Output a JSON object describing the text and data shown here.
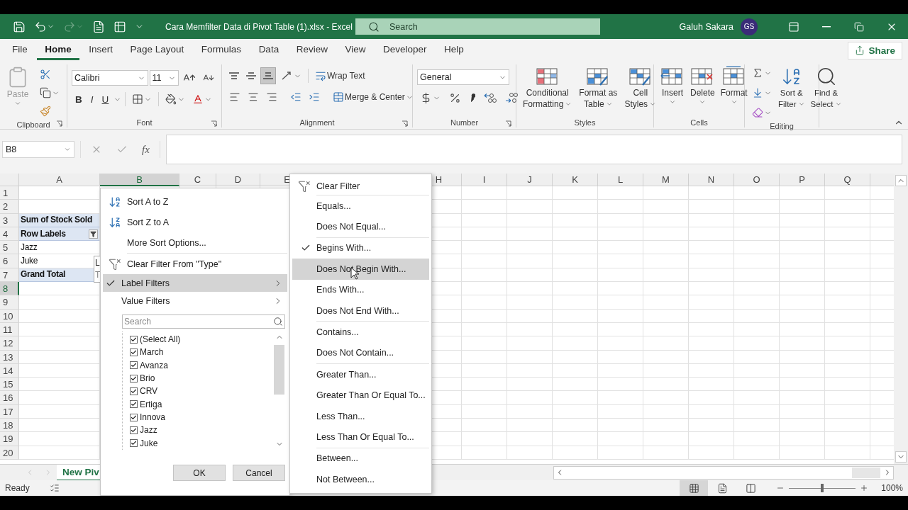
{
  "title_bar": {
    "title": "Cara Memfilter Data di Pivot Table (1).xlsx  -  Excel",
    "search_placeholder": "Search",
    "user": "Galuh Sakara",
    "initials": "GS"
  },
  "ribbon_tabs": [
    {
      "label": "File",
      "selected": false
    },
    {
      "label": "Home",
      "selected": true
    },
    {
      "label": "Insert",
      "selected": false
    },
    {
      "label": "Page Layout",
      "selected": false
    },
    {
      "label": "Formulas",
      "selected": false
    },
    {
      "label": "Data",
      "selected": false
    },
    {
      "label": "Review",
      "selected": false
    },
    {
      "label": "View",
      "selected": false
    },
    {
      "label": "Developer",
      "selected": false
    },
    {
      "label": "Help",
      "selected": false
    }
  ],
  "share": "Share",
  "clipboard": {
    "paste": "Paste",
    "label": "Clipboard"
  },
  "font": {
    "name": "Calibri",
    "size": "11",
    "bold": "B",
    "italic": "I",
    "underline": "U",
    "label": "Font"
  },
  "alignment": {
    "vertical": [
      {
        "kind": "top",
        "on": false
      },
      {
        "kind": "middle",
        "on": false
      },
      {
        "kind": "bottom",
        "on": true
      }
    ],
    "wrap_text": "Wrap Text",
    "merge": "Merge & Center",
    "label": "Alignment"
  },
  "number": {
    "format": "General",
    "label": "Number"
  },
  "styles": {
    "buttons": [
      {
        "kind": "conditional",
        "lines": [
          "Conditional",
          "Formatting"
        ]
      },
      {
        "kind": "table",
        "lines": [
          "Format as",
          "Table"
        ]
      },
      {
        "kind": "cell",
        "lines": [
          "Cell",
          "Styles"
        ]
      }
    ],
    "label": "Styles"
  },
  "cells": {
    "buttons": [
      {
        "kind": "insert",
        "label": "Insert"
      },
      {
        "kind": "delete",
        "label": "Delete"
      },
      {
        "kind": "format",
        "label": "Format"
      }
    ],
    "label": "Cells"
  },
  "editing": {
    "buttons": [
      {
        "kind": "sort",
        "lines": [
          "Sort &",
          "Filter"
        ]
      },
      {
        "kind": "find",
        "lines": [
          "Find &",
          "Select"
        ]
      }
    ],
    "label": "Editing"
  },
  "formula_bar": {
    "name_box": "B8",
    "fx": "fx"
  },
  "columns": [
    {
      "label": "A",
      "selected": false
    },
    {
      "label": "B",
      "selected": true
    },
    {
      "label": "C",
      "selected": false
    },
    {
      "label": "D",
      "selected": false
    },
    {
      "label": "E",
      "selected": false
    },
    {
      "label": "H",
      "selected": false
    },
    {
      "label": "I",
      "selected": false
    },
    {
      "label": "J",
      "selected": false
    },
    {
      "label": "K",
      "selected": false
    },
    {
      "label": "L",
      "selected": false
    },
    {
      "label": "M",
      "selected": false
    },
    {
      "label": "N",
      "selected": false
    },
    {
      "label": "O",
      "selected": false
    },
    {
      "label": "P",
      "selected": false
    },
    {
      "label": "Q",
      "selected": false
    }
  ],
  "rows": [
    {
      "number": "1",
      "selected": false
    },
    {
      "number": "2",
      "selected": false
    },
    {
      "number": "3",
      "selected": false,
      "a": {
        "kind": "title",
        "text": "Sum of Stock Sold"
      }
    },
    {
      "number": "4",
      "selected": false,
      "a": {
        "kind": "header",
        "text": "Row Labels"
      }
    },
    {
      "number": "5",
      "selected": false,
      "a": {
        "kind": "item",
        "text": "Jazz"
      }
    },
    {
      "number": "6",
      "selected": false,
      "a": {
        "kind": "item",
        "text": "Juke"
      }
    },
    {
      "number": "7",
      "selected": false,
      "a": {
        "kind": "total",
        "text": "Grand Total"
      }
    },
    {
      "number": "8",
      "selected": true
    },
    {
      "number": "9",
      "selected": false
    },
    {
      "number": "10",
      "selected": false
    },
    {
      "number": "11",
      "selected": false
    },
    {
      "number": "12",
      "selected": false
    },
    {
      "number": "13",
      "selected": false
    },
    {
      "number": "14",
      "selected": false
    },
    {
      "number": "15",
      "selected": false
    },
    {
      "number": "16",
      "selected": false
    },
    {
      "number": "17",
      "selected": false
    },
    {
      "number": "18",
      "selected": false
    },
    {
      "number": "19",
      "selected": false
    },
    {
      "number": "20",
      "selected": false
    }
  ],
  "tooltip": {
    "lines": [
      "L",
      "T"
    ]
  },
  "sheet_tabs": [
    {
      "label": "New Piv",
      "selected": true
    }
  ],
  "status_bar": {
    "text": "Ready",
    "views": [
      {
        "kind": "normal",
        "selected": true
      },
      {
        "kind": "page_layout",
        "selected": false
      },
      {
        "kind": "page_break",
        "selected": false
      }
    ],
    "zoom_slider": {
      "level": 0.5
    },
    "zoom": "100%"
  },
  "filter_menu": {
    "sort": [
      {
        "kind": "az",
        "label": "Sort A to Z"
      },
      {
        "kind": "za",
        "label": "Sort Z to A"
      },
      {
        "kind": "more",
        "label": "More Sort Options..."
      }
    ],
    "clear": "Clear Filter From \"Type\"",
    "filters": [
      {
        "label": "Label Filters",
        "checked": true,
        "selected": true
      },
      {
        "label": "Value Filters",
        "checked": false,
        "selected": false
      }
    ],
    "search_placeholder": "Search",
    "items": [
      {
        "label": "(Select All)",
        "checked": true
      },
      {
        "label": "March",
        "checked": true
      },
      {
        "label": "Avanza",
        "checked": true
      },
      {
        "label": "Brio",
        "checked": true
      },
      {
        "label": "CRV",
        "checked": true
      },
      {
        "label": "Ertiga",
        "checked": true
      },
      {
        "label": "Innova",
        "checked": true
      },
      {
        "label": "Jazz",
        "checked": true
      },
      {
        "label": "Juke",
        "checked": true
      }
    ],
    "ok": "OK",
    "cancel": "Cancel"
  },
  "submenu": {
    "clear": "Clear Filter",
    "groups": [
      {
        "items": [
          {
            "label": "Equals...",
            "checked": false,
            "selected": false
          },
          {
            "label": "Does Not Equal...",
            "checked": false,
            "selected": false
          }
        ]
      },
      {
        "items": [
          {
            "label": "Begins With...",
            "checked": true,
            "selected": false
          },
          {
            "label": "Does Not Begin With...",
            "checked": false,
            "selected": true
          },
          {
            "label": "Ends With...",
            "checked": false,
            "selected": false
          },
          {
            "label": "Does Not End With...",
            "checked": false,
            "selected": false
          }
        ]
      },
      {
        "items": [
          {
            "label": "Contains...",
            "checked": false,
            "selected": false
          },
          {
            "label": "Does Not Contain...",
            "checked": false,
            "selected": false
          }
        ]
      },
      {
        "items": [
          {
            "label": "Greater Than...",
            "checked": false,
            "selected": false
          },
          {
            "label": "Greater Than Or Equal To...",
            "checked": false,
            "selected": false
          },
          {
            "label": "Less Than...",
            "checked": false,
            "selected": false
          },
          {
            "label": "Less Than Or Equal To...",
            "checked": false,
            "selected": false
          }
        ]
      },
      {
        "items": [
          {
            "label": "Between...",
            "checked": false,
            "selected": false
          },
          {
            "label": "Not Between...",
            "checked": false,
            "selected": false
          }
        ]
      }
    ]
  }
}
